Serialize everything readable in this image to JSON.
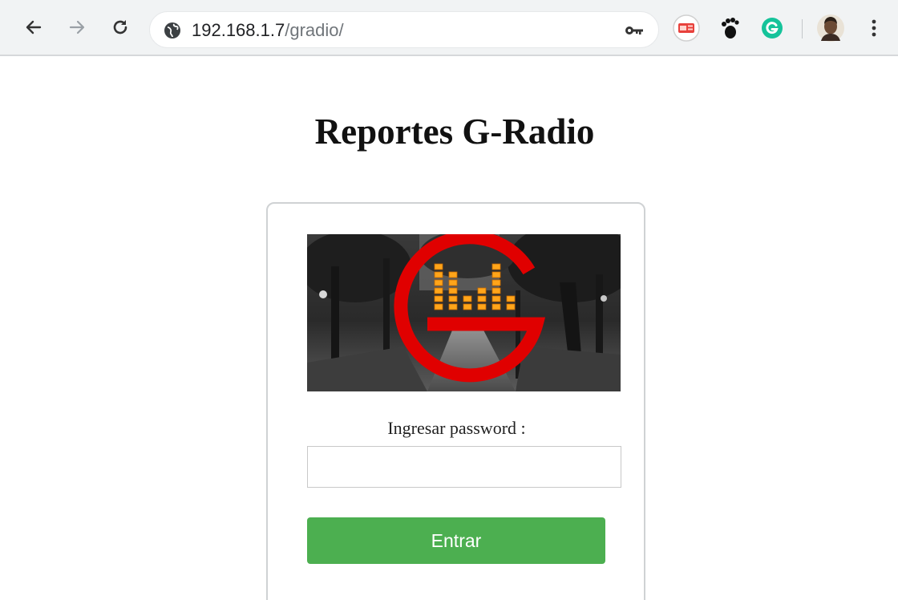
{
  "browser": {
    "url_host": "192.168.1.7",
    "url_path": "/gradio/"
  },
  "page": {
    "title": "Reportes G-Radio",
    "password_label": "Ingresar password :",
    "password_value": "",
    "submit_label": "Entrar"
  },
  "colors": {
    "submit_button": "#4caf50",
    "logo_red": "#e00000",
    "logo_bars": "#ffa51a"
  }
}
